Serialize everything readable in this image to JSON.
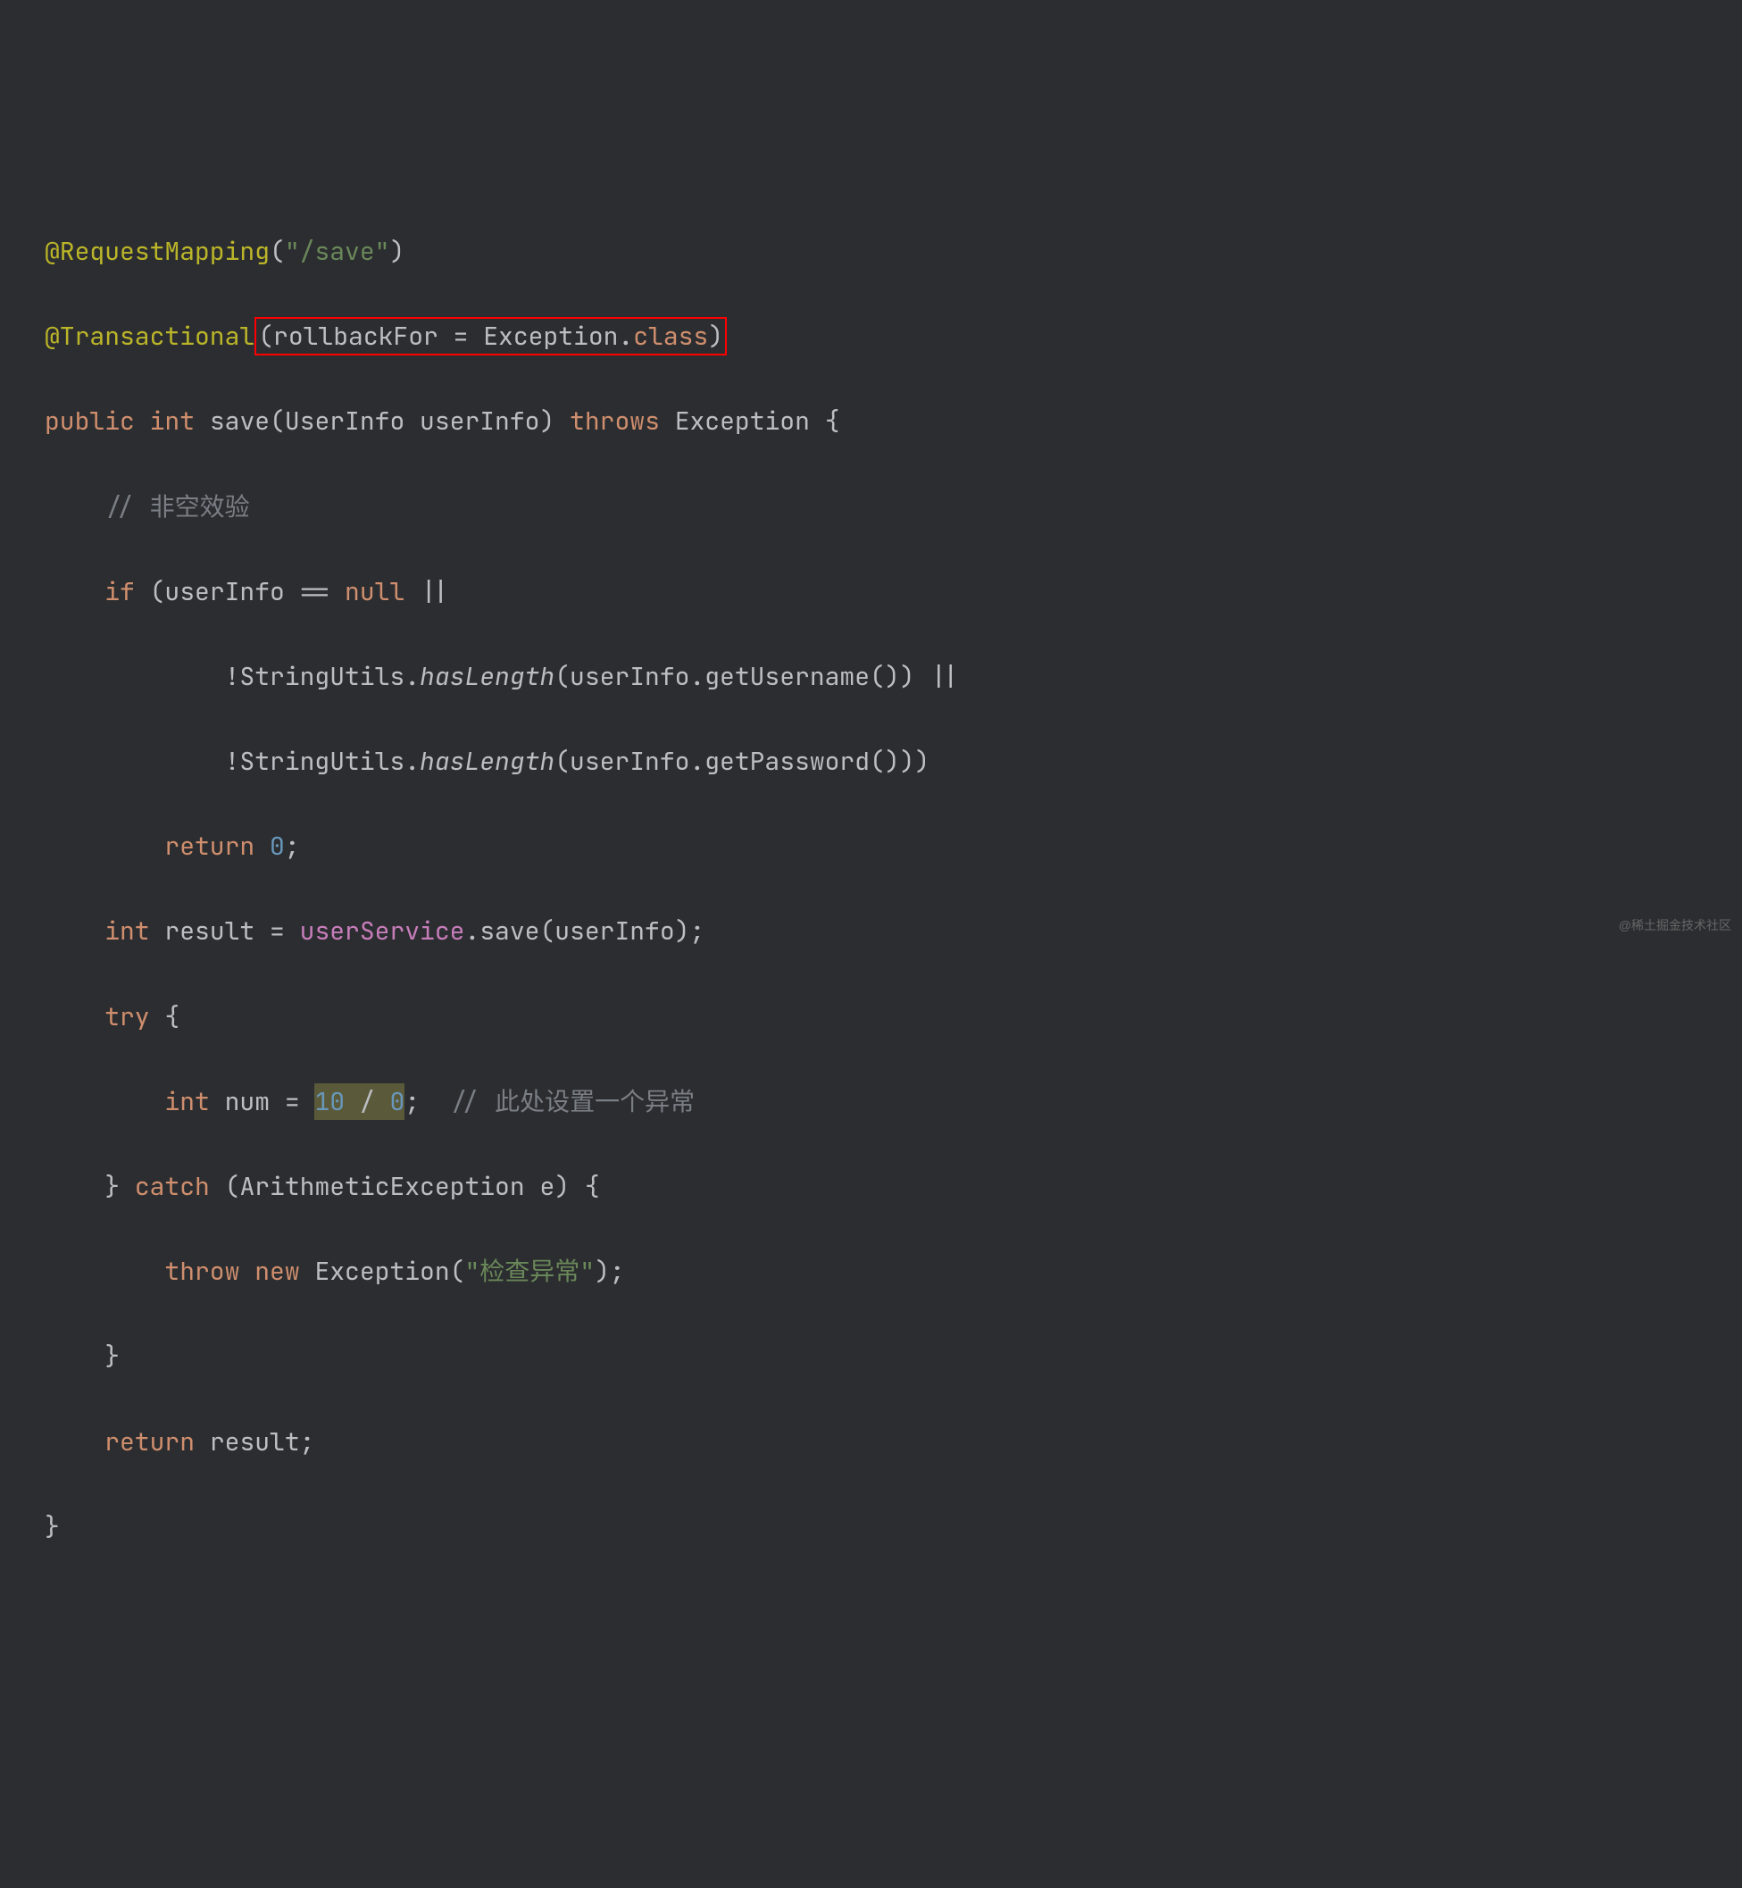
{
  "code": {
    "line1": {
      "annotation": "@RequestMapping",
      "paren_open": "(",
      "string": "\"/save\"",
      "paren_close": ")"
    },
    "line2": {
      "annotation": "@Transactional",
      "boxed": {
        "paren_open": "(",
        "param": "rollbackFor = Exception.",
        "class_kw": "class",
        "paren_close": ")"
      }
    },
    "line3": {
      "public": "public",
      "int": "int",
      "method": "save",
      "params": "(UserInfo userInfo)",
      "throws": "throws",
      "exception": "Exception {"
    },
    "line4": {
      "comment": "// 非空效验"
    },
    "line5": {
      "if": "if",
      "condition": "(userInfo ==",
      "null": "null",
      "or": "||"
    },
    "line6": {
      "neg": "!StringUtils.",
      "method": "hasLength",
      "args": "(userInfo.getUsername()) ||"
    },
    "line7": {
      "neg": "!StringUtils.",
      "method": "hasLength",
      "args": "(userInfo.getPassword()))"
    },
    "line8": {
      "return": "return",
      "value": "0",
      "semi": ";"
    },
    "line9": {
      "int": "int",
      "var": "result =",
      "service": "userService",
      "call": ".save(userInfo);"
    },
    "line10": {
      "try": "try",
      "brace": "{"
    },
    "line11": {
      "int": "int",
      "var": "num =",
      "ten": "10",
      "div": "/",
      "zero": "0",
      "semi": ";",
      "comment": "// 此处设置一个异常"
    },
    "line12": {
      "brace": "}",
      "catch": "catch",
      "params": "(ArithmeticException e) {"
    },
    "line13": {
      "throw": "throw",
      "new": "new",
      "exc": "Exception(",
      "string": "\"检查异常\"",
      "close": ");"
    },
    "line14": {
      "brace": "}"
    },
    "line15": {
      "return": "return",
      "var": "result;"
    },
    "line16": {
      "brace": "}"
    }
  },
  "watermark": "@稀土掘金技术社区"
}
